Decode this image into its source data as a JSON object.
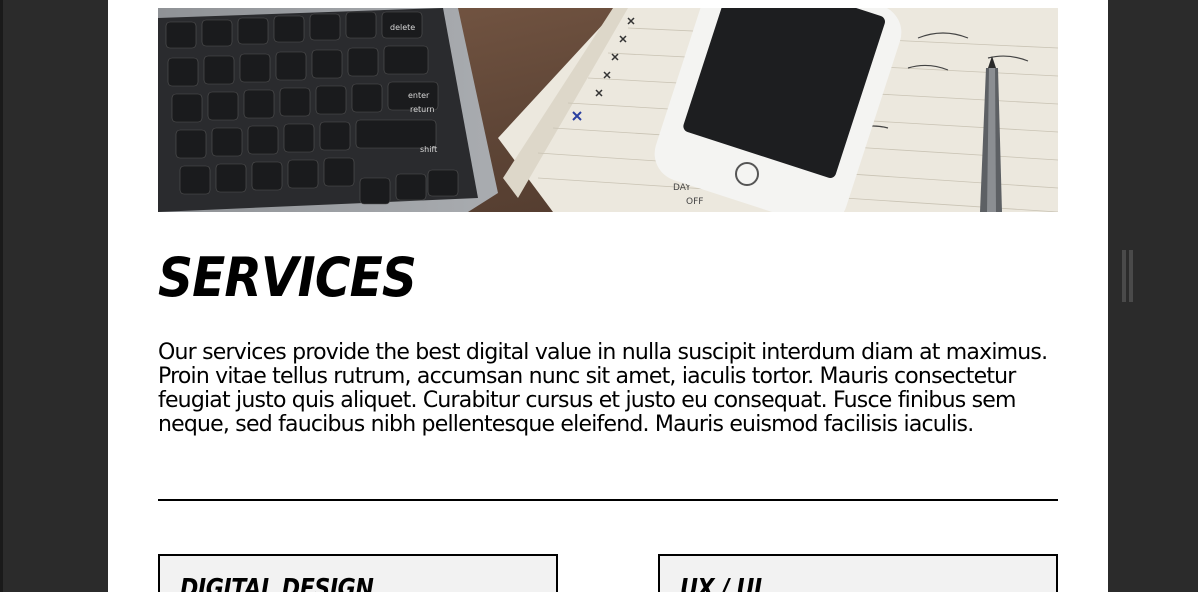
{
  "services": {
    "title": "SERVICES",
    "description": "Our services provide the best digital value in nulla suscipit interdum diam at maximus. Proin vitae tellus rutrum, accumsan nunc sit amet, iaculis tortor. Mauris consectetur feugiat justo quis aliquet. Curabitur cursus et justo eu consequat. Fusce finibus sem neque, sed faucibus nibh pellentesque eleifend. Mauris euismod facilisis iaculis.",
    "cards": [
      {
        "title": "DIGITAL DESIGN"
      },
      {
        "title": "UX / UI"
      }
    ]
  },
  "hero": {
    "keys": [
      "delete",
      "enter",
      "return",
      "shift"
    ],
    "notes": [
      "DAY",
      "OFF"
    ]
  },
  "colors": {
    "page_background": "#ffffff",
    "outer_background": "#2b2b2b",
    "text": "#000000",
    "card_background": "#f2f2f2"
  },
  "icons": [
    "laptop-keyboard-image",
    "smartphone-image",
    "notebook-image",
    "pen-image",
    "scroll-handle-icon"
  ]
}
